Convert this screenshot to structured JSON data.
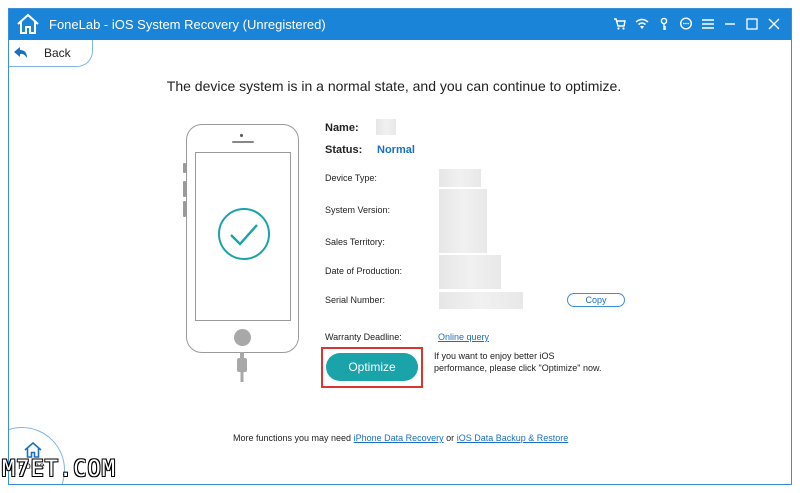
{
  "window": {
    "title": "FoneLab - iOS System Recovery (Unregistered)"
  },
  "titlebar_icons": [
    "cart-icon",
    "wifi-icon",
    "key-icon",
    "chat-icon",
    "menu-icon",
    "minimize-icon",
    "maximize-icon",
    "close-icon"
  ],
  "nav": {
    "back_label": "Back"
  },
  "headline": "The device system is in a normal state, and you can continue to optimize.",
  "device": {
    "name_label": "Name:",
    "status_label": "Status:",
    "status_value": "Normal",
    "fields": [
      {
        "label": "Device Type:"
      },
      {
        "label": "System Version:"
      },
      {
        "label": "Sales Territory:"
      },
      {
        "label": "Date of Production:"
      },
      {
        "label": "Serial Number:"
      }
    ],
    "copy_label": "Copy",
    "warranty_label": "Warranty Deadline:",
    "warranty_link": "Online query"
  },
  "optimize": {
    "button_label": "Optimize",
    "hint": "If you want to enjoy better iOS performance, please click \"Optimize\" now."
  },
  "footer": {
    "prefix": "More functions you may need",
    "link1": "iPhone Data Recovery",
    "separator": "or",
    "link2": "iOS Data Backup & Restore"
  },
  "home": {
    "label": "Home"
  },
  "watermark": "M7ET.COM",
  "colors": {
    "titlebar": "#1a84d8",
    "accent_blue": "#1a6fc0",
    "optimize_button": "#1aa3a8",
    "highlight_frame": "#d9362f"
  }
}
